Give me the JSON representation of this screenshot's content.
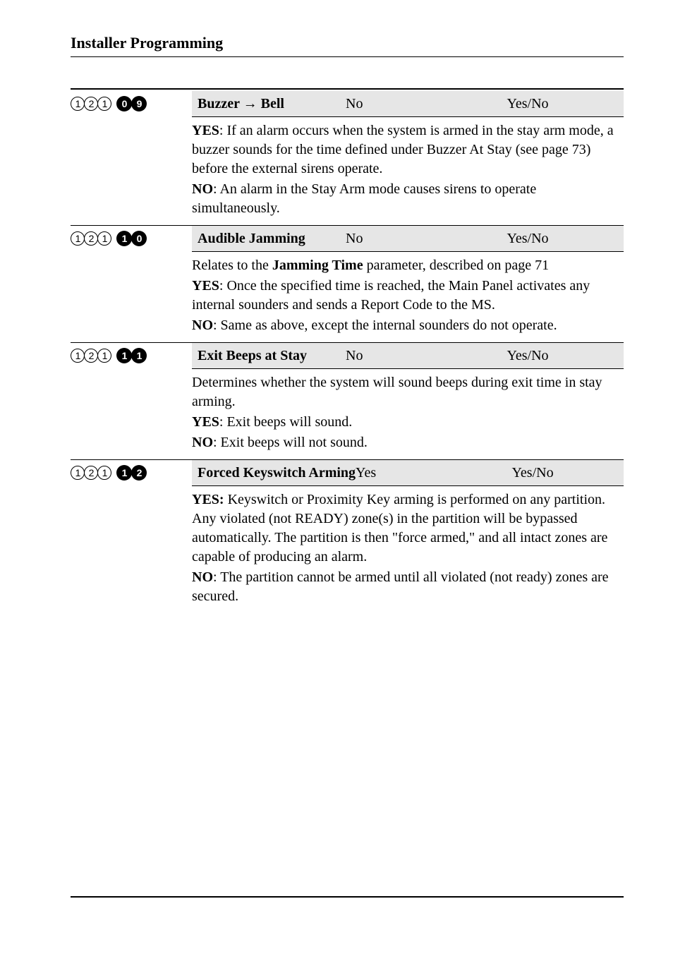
{
  "header": {
    "title": "Installer Programming"
  },
  "sections": [
    {
      "code": {
        "outline": [
          "1",
          "2",
          "1"
        ],
        "filled": [
          "0",
          "9"
        ]
      },
      "param": {
        "name": "Buzzer → Bell",
        "default": "No",
        "range": "Yes/No"
      },
      "desc": [
        {
          "bold": "YES",
          "text": ": If an alarm occurs when the system is armed in the stay arm mode, a buzzer sounds for the time defined under Buzzer At Stay (see page 73) before the external sirens operate."
        },
        {
          "bold": "NO",
          "text": ": An alarm in the Stay Arm mode causes sirens to operate simultaneously."
        }
      ]
    },
    {
      "code": {
        "outline": [
          "1",
          "2",
          "1"
        ],
        "filled": [
          "1",
          "0"
        ]
      },
      "param": {
        "name": "Audible Jamming",
        "default": "No",
        "range": "Yes/No"
      },
      "desc": [
        {
          "text": "Relates to the ",
          "bold_mid": "Jamming Time",
          "text_after": " parameter, described on page 71"
        },
        {
          "bold": "YES",
          "text": ": Once the specified time is reached, the Main Panel activates any internal sounders and sends a Report Code to the MS."
        },
        {
          "bold": "NO",
          "text": ": Same as above, except the internal sounders do not operate."
        }
      ]
    },
    {
      "code": {
        "outline": [
          "1",
          "2",
          "1"
        ],
        "filled": [
          "1",
          "1"
        ]
      },
      "param": {
        "name": "Exit Beeps at Stay",
        "default": "No",
        "range": "Yes/No"
      },
      "desc": [
        {
          "text": "Determines whether the system will sound beeps during exit time in stay arming."
        },
        {
          "bold": "YES",
          "text": ": Exit beeps will sound."
        },
        {
          "bold": "NO",
          "text": ": Exit beeps will not sound."
        }
      ]
    },
    {
      "code": {
        "outline": [
          "1",
          "2",
          "1"
        ],
        "filled": [
          "1",
          "2"
        ]
      },
      "param": {
        "name": "Forced Keyswitch Arming",
        "default": "Yes",
        "range": "Yes/No"
      },
      "desc": [
        {
          "bold": "YES:",
          "text": " Keyswitch or Proximity Key arming is performed on any partition. Any violated (not READY) zone(s) in the partition will be bypassed automatically. The partition is then \"force armed,\" and all intact zones are capable of producing an alarm."
        },
        {
          "bold": "NO",
          "text": ": The partition cannot be armed until all violated (not ready) zones are secured."
        }
      ]
    }
  ]
}
